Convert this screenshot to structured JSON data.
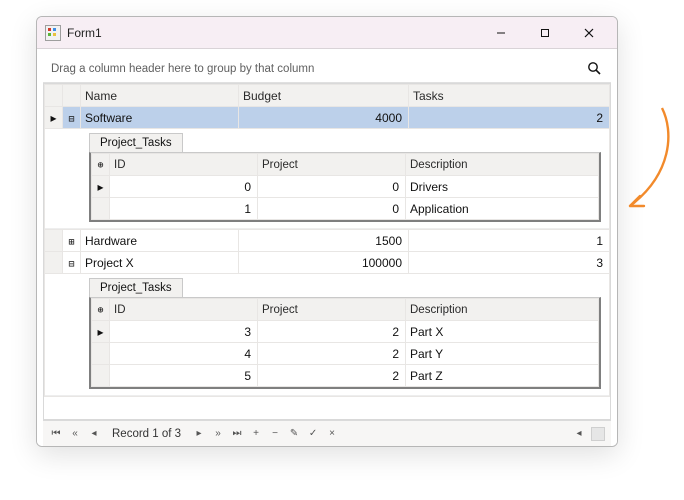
{
  "window": {
    "title": "Form1"
  },
  "groupbar": {
    "hint": "Drag a column header here to group by that column"
  },
  "columns": {
    "name": "Name",
    "budget": "Budget",
    "tasks": "Tasks"
  },
  "child": {
    "tab": "Project_Tasks",
    "cols": {
      "id": "ID",
      "project": "Project",
      "description": "Description"
    }
  },
  "rows": [
    {
      "expanded": true,
      "selected": true,
      "name": "Software",
      "budget": "4000",
      "tasks": "2",
      "children": [
        {
          "id": "0",
          "project": "0",
          "description": "Drivers",
          "current": true
        },
        {
          "id": "1",
          "project": "0",
          "description": "Application"
        }
      ]
    },
    {
      "expanded": false,
      "name": "Hardware",
      "budget": "1500",
      "tasks": "1"
    },
    {
      "expanded": true,
      "name": "Project X",
      "budget": "100000",
      "tasks": "3",
      "children": [
        {
          "id": "3",
          "project": "2",
          "description": "Part X",
          "current": true
        },
        {
          "id": "4",
          "project": "2",
          "description": "Part Y"
        },
        {
          "id": "5",
          "project": "2",
          "description": "Part Z"
        }
      ]
    }
  ],
  "navigator": {
    "record": "Record 1 of 3"
  }
}
